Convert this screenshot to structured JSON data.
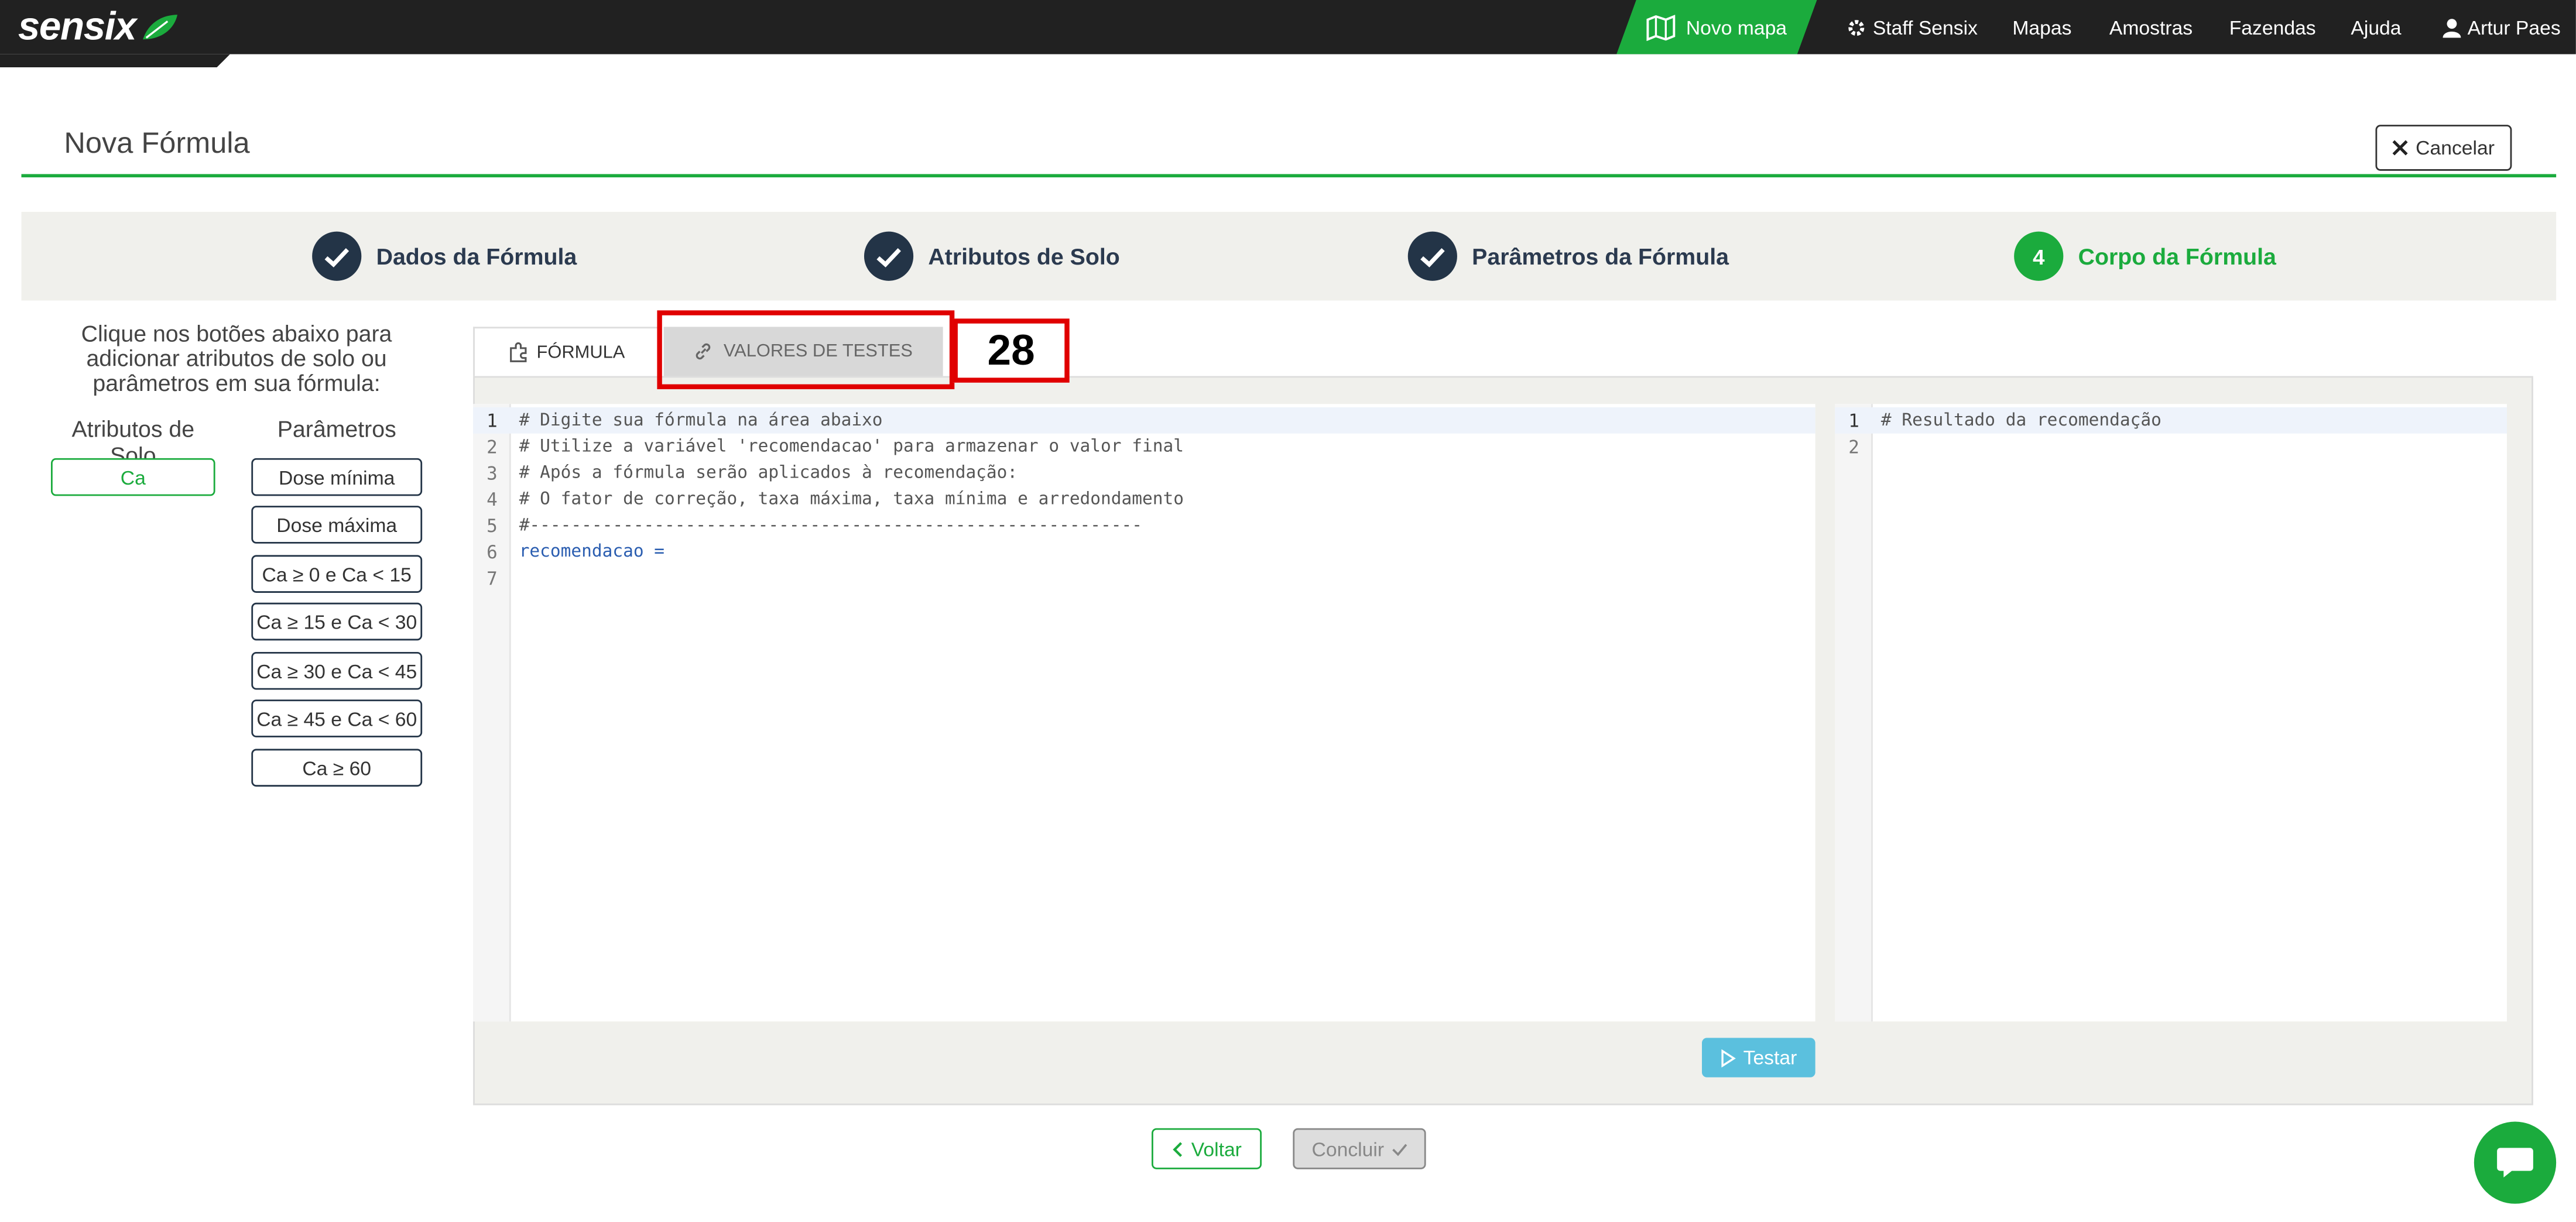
{
  "topnav": {
    "logo_text": "sensix",
    "new_map": "Novo mapa",
    "items": [
      {
        "label": "Staff Sensix",
        "icon": "gear-icon"
      },
      {
        "label": "Mapas"
      },
      {
        "label": "Amostras"
      },
      {
        "label": "Fazendas"
      },
      {
        "label": "Ajuda"
      },
      {
        "label": "Artur Paes",
        "icon": "user-icon"
      }
    ]
  },
  "header": {
    "title": "Nova Fórmula",
    "cancel_label": "Cancelar"
  },
  "steps": [
    {
      "number": "",
      "label": "Dados da Fórmula",
      "state": "done"
    },
    {
      "number": "",
      "label": "Atributos de Solo",
      "state": "done"
    },
    {
      "number": "",
      "label": "Parâmetros da Fórmula",
      "state": "done"
    },
    {
      "number": "4",
      "label": "Corpo da Fórmula",
      "state": "active"
    }
  ],
  "left_panel": {
    "hint": "Clique nos botões abaixo para adicionar atributos de solo ou parâmetros em sua fórmula:",
    "soil_header": "Atributos de Solo",
    "params_header": "Parâmetros",
    "soil_attributes": [
      "Ca"
    ],
    "parameters": [
      "Dose mínima",
      "Dose máxima",
      "Ca ≥ 0 e Ca < 15",
      "Ca ≥ 15 e Ca < 30",
      "Ca ≥ 30 e Ca < 45",
      "Ca ≥ 45 e Ca < 60",
      "Ca ≥ 60"
    ]
  },
  "tabs": {
    "formula": "FÓRMULA",
    "test_values": "VALORES DE TESTES"
  },
  "annotation_label": "28",
  "formula_editor": {
    "lines": [
      "# Digite sua fórmula na área abaixo",
      "# Utilize a variável 'recomendacao' para armazenar o valor final",
      "# Após a fórmula serão aplicados à recomendação:",
      "# O fator de correção, taxa máxima, taxa mínima e arredondamento",
      "#-----------------------------------------------------------",
      "recomendacao =",
      ""
    ]
  },
  "result_editor": {
    "lines": [
      "# Resultado da recomendação",
      ""
    ]
  },
  "buttons": {
    "test": "Testar",
    "back": "Voltar",
    "finish": "Concluir"
  },
  "colors": {
    "brand_green": "#1bab3d",
    "nav_dark": "#212121",
    "step_navy": "#233447",
    "test_blue": "#5bc0de",
    "annotation_red": "#e00000"
  }
}
